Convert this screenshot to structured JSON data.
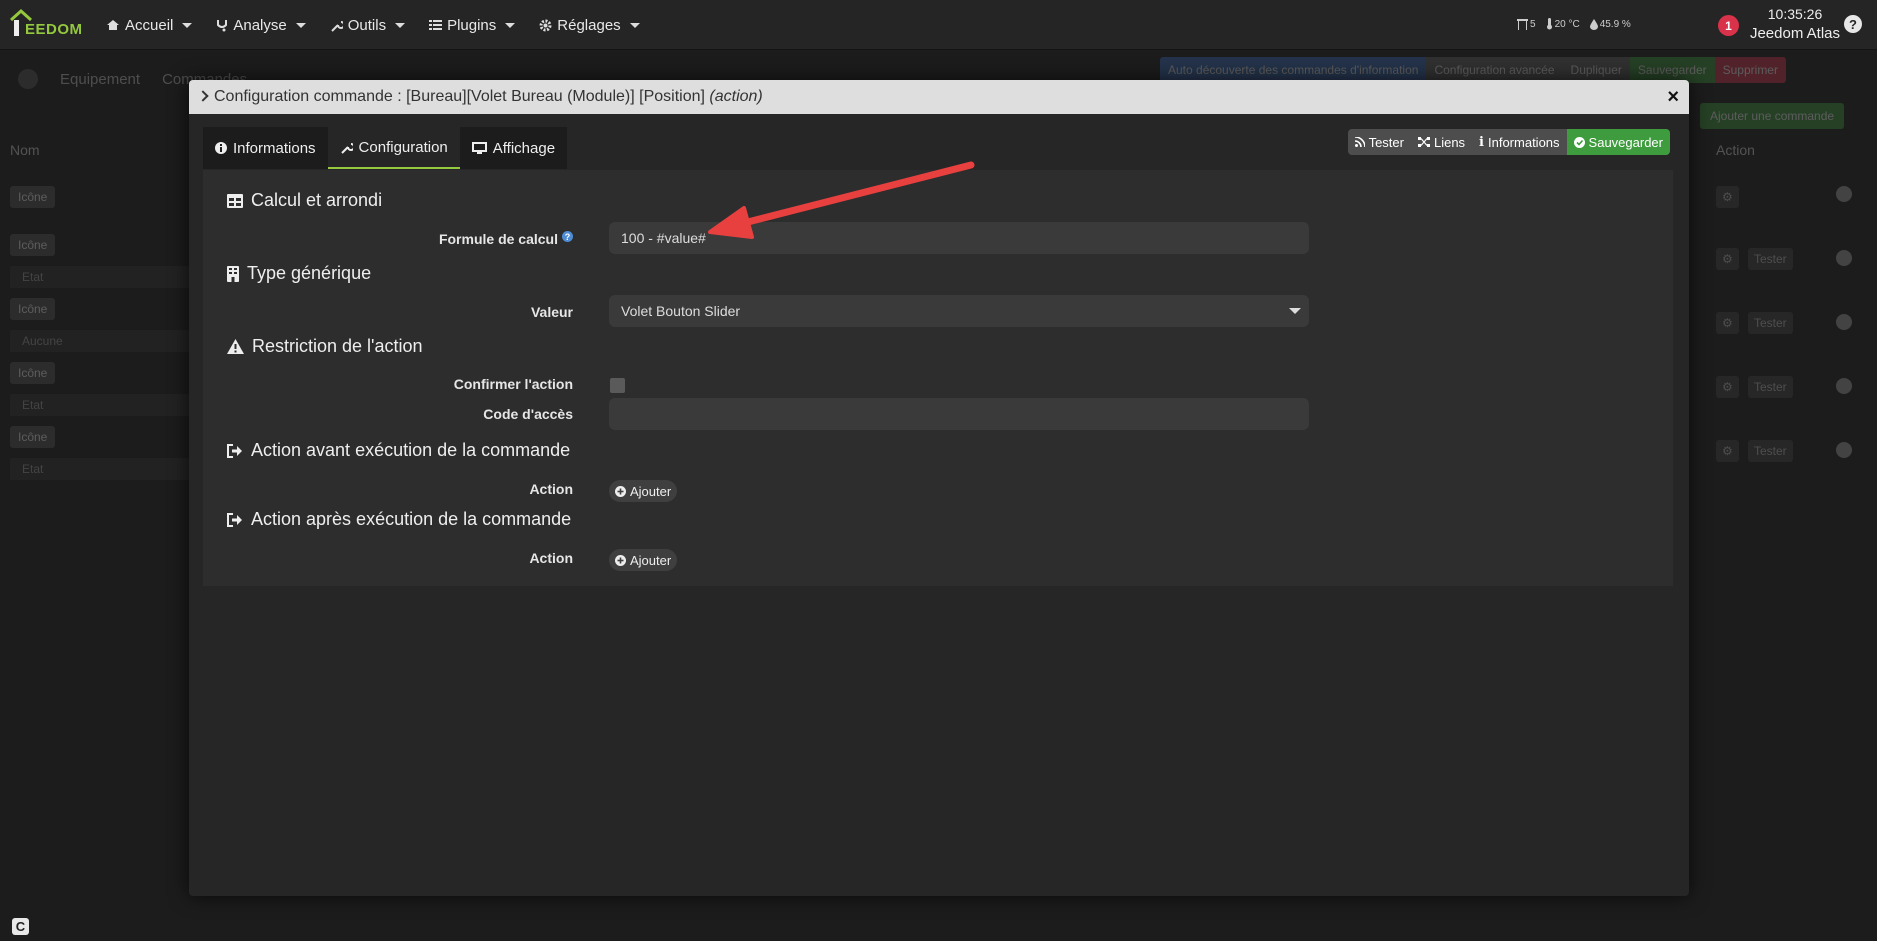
{
  "navbar": {
    "brand": "EEDOM",
    "menu": [
      {
        "label": "Accueil",
        "icon": "home-icon"
      },
      {
        "label": "Analyse",
        "icon": "stethoscope-icon"
      },
      {
        "label": "Outils",
        "icon": "wrench-icon"
      },
      {
        "label": "Plugins",
        "icon": "tasks-icon"
      },
      {
        "label": "Réglages",
        "icon": "gear-icon"
      }
    ],
    "weather": {
      "shutter": "5",
      "temperature": "20 °C",
      "humidity": "45.9 %"
    },
    "notifications": "1",
    "time": "10:35:26",
    "user": "Jeedom Atlas"
  },
  "background": {
    "tabs": [
      "Equipement",
      "Commandes"
    ],
    "toolbar": [
      "Auto découverte des commandes d'information",
      "Configuration avancée",
      "Dupliquer",
      "Sauvegarder",
      "Supprimer"
    ],
    "add_command": "Ajouter une commande",
    "col_name": "Nom",
    "col_action": "Action",
    "chip": "Icône",
    "rows_sub": [
      "Etat",
      "Aucune",
      "Etat",
      "Etat"
    ],
    "test_label": "Tester"
  },
  "modal": {
    "title_main": "Configuration commande : [Bureau][Volet Bureau (Module)] [Position] ",
    "title_type": "(action)",
    "close": "×",
    "tabs": [
      "Informations",
      "Configuration",
      "Affichage"
    ],
    "actions": [
      "Tester",
      "Liens",
      "Informations",
      "Sauvegarder"
    ],
    "sections": {
      "calc": "Calcul et arrondi",
      "generic": "Type générique",
      "restriction": "Restriction de l'action",
      "before": "Action avant exécution de la commande",
      "after": "Action après exécution de la commande"
    },
    "fields": {
      "formula_label": "Formule de calcul",
      "formula_value": "100 - #value#",
      "value_label": "Valeur",
      "value_selected": "Volet Bouton Slider",
      "confirm_label": "Confirmer l'action",
      "confirm_checked": false,
      "code_label": "Code d'accès",
      "code_value": "",
      "action_label": "Action",
      "add_label": "Ajouter"
    }
  },
  "colors": {
    "accent_green": "#94c93d",
    "save_green": "#3e9c3e",
    "danger": "#d9324b",
    "annotation_arrow": "#e8403f"
  }
}
